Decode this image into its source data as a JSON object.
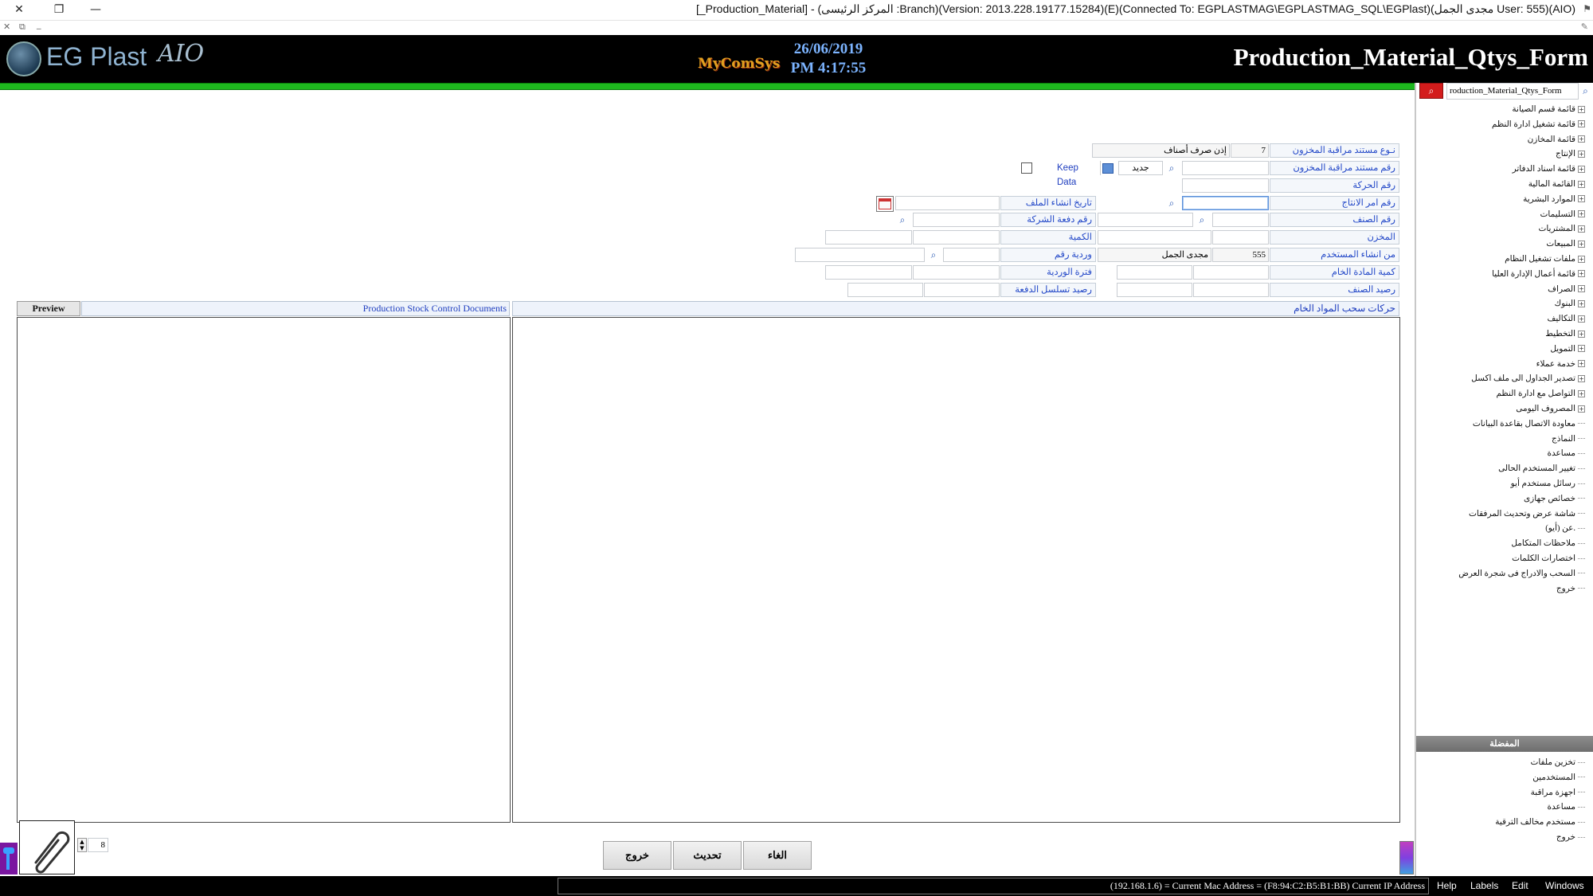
{
  "window": {
    "title": "[_Production_Material] - (المركز الرئيسى :Branch)(Version: 2013.228.19177.15284)(E)(Connected To: EGPLASTMAG\\EGPLASTMAG_SQL\\EGPlast)(مجدى الجمل User: 555)(AIO)",
    "close_glyph": "✕",
    "restore_glyph": "❐",
    "minimize_glyph": "—",
    "sub_close_glyph": "✕",
    "sub_restore_glyph": "⧉",
    "sub_min_glyph": "_"
  },
  "header": {
    "logo_text": "EG Plast",
    "logo_aio": "AIO",
    "brand_small": "MyComSys",
    "date": "26/06/2019",
    "time": "PM 4:17:55",
    "form_title": "Production_Material_Qtys_Form"
  },
  "form": {
    "doc_type_label": "نـوع مستند مراقبة المخزون",
    "doc_type_code": "7",
    "doc_type_name": "إذن صرف أصناف",
    "doc_no_label": "رقم مستند مراقبة المخزون",
    "doc_no_value": "",
    "new_label": "جديد",
    "keep_data_label": "Keep Data",
    "movement_no_label": "رقم الحركة",
    "production_order_label": "رقم امر الانتاج",
    "production_order_value": "",
    "file_date_label": "تاريخ انشاء الملف",
    "file_date_value": "",
    "item_no_label": "رقم الصنف",
    "company_batch_label": "رقم دفعة الشركة",
    "store_label": "المخزن",
    "quantity_label": "الكمية",
    "created_by_label": "من انشاء المستخدم",
    "created_by_code": "555",
    "created_by_name": "مجدى الجمل",
    "shift_no_label": "وردية رقم",
    "raw_qty_label": "كمية المادة الخام",
    "shift_period_label": "فترة الوردية",
    "item_balance_label": "رصيد الصنف",
    "batch_serial_balance_label": "رصيد تسلسل الدفعة"
  },
  "panels": {
    "left_preview_tab": "Preview",
    "left_title": "Production Stock Control Documents",
    "right_title": "حركات سحب المواد الخام"
  },
  "pager": {
    "value": "8"
  },
  "buttons": {
    "exit": "خروج",
    "refresh": "تحديث",
    "cancel": "الغاء"
  },
  "sidebar": {
    "search_value": "roduction_Material_Qtys_Form",
    "items": [
      {
        "label": "قائمة قسم الصيانة",
        "expandable": true
      },
      {
        "label": "قائمة تشغيل ادارة النظم",
        "expandable": true
      },
      {
        "label": "قائمة المخازن",
        "expandable": true
      },
      {
        "label": "الإنتاج",
        "expandable": true
      },
      {
        "label": "قائمة اسناد الدفاتر",
        "expandable": true
      },
      {
        "label": "القائمة المالية",
        "expandable": true
      },
      {
        "label": "الموارد البشرية",
        "expandable": true
      },
      {
        "label": "التسليمات",
        "expandable": true
      },
      {
        "label": "المشتريات",
        "expandable": true
      },
      {
        "label": "المبيعات",
        "expandable": true
      },
      {
        "label": "ملفات تشغيل النظام",
        "expandable": true
      },
      {
        "label": "قائمة أعمال الإدارة العليا",
        "expandable": true
      },
      {
        "label": "الصراف",
        "expandable": true
      },
      {
        "label": "البنوك",
        "expandable": true
      },
      {
        "label": "التكاليف",
        "expandable": true
      },
      {
        "label": "التخطيط",
        "expandable": true
      },
      {
        "label": "التمويل",
        "expandable": true
      },
      {
        "label": "خدمة عملاء",
        "expandable": true
      },
      {
        "label": "تصدير الجداول الى ملف اكسل",
        "expandable": true
      },
      {
        "label": "التواصل مع ادارة النظم",
        "expandable": true
      },
      {
        "label": "المصروف اليومى",
        "expandable": true
      },
      {
        "label": "معاودة الاتصال بقاعدة البيانات",
        "expandable": false
      },
      {
        "label": "النماذج",
        "expandable": false
      },
      {
        "label": "مساعدة",
        "expandable": false
      },
      {
        "label": "تغيير المستخدم الحالى",
        "expandable": false
      },
      {
        "label": "رسائل مستخدم أيو",
        "expandable": false
      },
      {
        "label": "خصائص جهازى",
        "expandable": false
      },
      {
        "label": "شاشة عرض وتحديث المرفقات",
        "expandable": false
      },
      {
        "label": "عن (أيو).",
        "expandable": false
      },
      {
        "label": "ملاحظات المتكامل",
        "expandable": false
      },
      {
        "label": "اختصارات الكلمات",
        "expandable": false
      },
      {
        "label": "السحب والادراج فى شجرة العرض",
        "expandable": false
      },
      {
        "label": "خروج",
        "expandable": false
      }
    ],
    "favorites_title": "المفضلة",
    "favorites": [
      "تخزين ملفات",
      "المستخدمين",
      "اجهزة مراقبة",
      "مساعدة",
      "مستخدم مخالف الترقية",
      "خروج"
    ]
  },
  "statusbar": {
    "network": "(192.168.1.6) = Current Mac Address = (F8:94:C2:B5:B1:BB) Current IP Address",
    "menu": [
      "Help",
      "Labels",
      "Edit",
      "Windows"
    ]
  },
  "colors": {
    "header_bg": "#000000",
    "green_bar": "#1eb81e",
    "label_text": "#2449c8",
    "date_text": "#7cb4ff"
  }
}
